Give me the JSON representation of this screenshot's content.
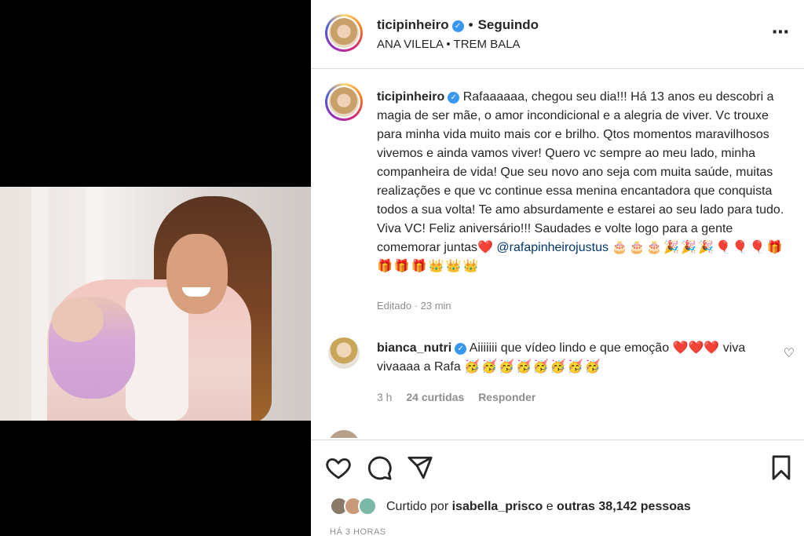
{
  "post": {
    "username": "ticipinheiro",
    "follow_status": "Seguindo",
    "audio": "ANA VILELA • TREM BALA",
    "more_icon": "⋯"
  },
  "caption": {
    "username": "ticipinheiro",
    "text": "Rafaaaaaa, chegou seu dia!!! Há 13 anos eu descobri a magia de ser mãe, o amor incondicional e a alegria de viver. Vc trouxe para minha vida muito mais cor e brilho. Qtos momentos maravilhosos vivemos e ainda vamos viver! Quero vc sempre ao meu lado, minha companheira de vida! Que seu novo ano seja com muita saúde, muitas realizações e que vc continue essa menina encantadora que conquista todos a sua volta! Te amo absurdamente e estarei ao seu lado para tudo. Viva VC! Feliz aniversário!!! Saudades e volte logo para a gente comemorar juntas",
    "heart": "❤️",
    "mention": "@rafapinheirojustus",
    "emojis": "🎂🎂🎂🎉🎉🎉🎈🎈🎈🎁🎁🎁🎁👑👑👑",
    "edited": "Editado · 23 min"
  },
  "comment": {
    "username": "bianca_nutri",
    "text": "Aiiiiiii que vídeo lindo e que emoção",
    "hearts": "❤️❤️❤️",
    "text2": "viva vivaaaa a Rafa",
    "emojis": "🥳🥳🥳🥳🥳🥳🥳🥳",
    "time": "3 h",
    "likes": "24 curtidas",
    "reply": "Responder"
  },
  "likes": {
    "prefix": "Curtido por",
    "user": "isabella_prisco",
    "mid": "e",
    "others": "outras 38,142 pessoas"
  },
  "time_ago": "HÁ 3 HORAS",
  "colors": {
    "verified": "#3897f0",
    "mention": "#00376b",
    "secondary_text": "#8e8e8e"
  }
}
